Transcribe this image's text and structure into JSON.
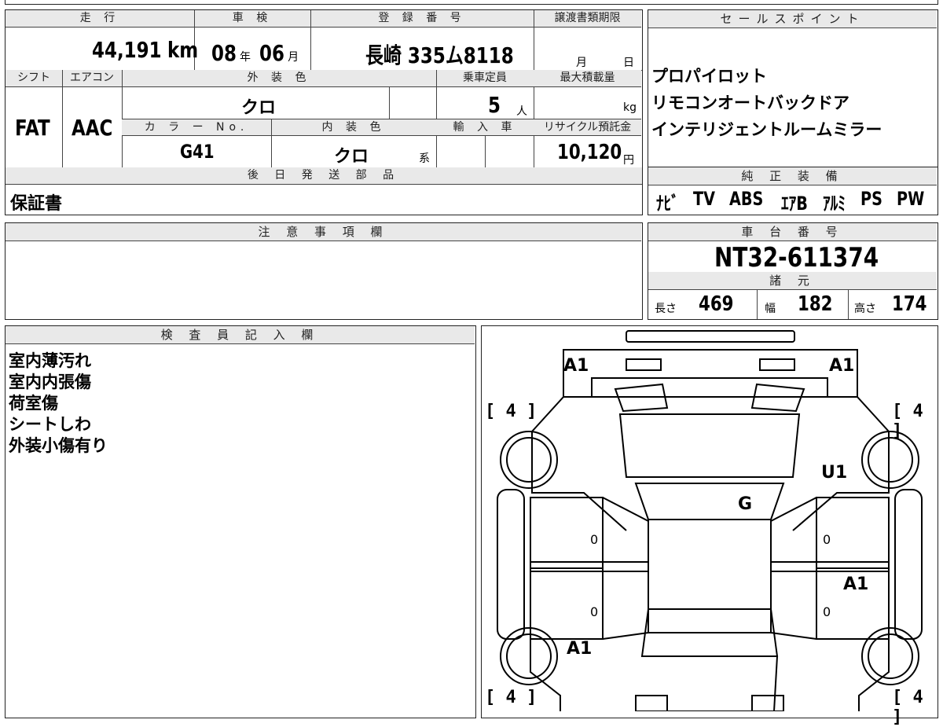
{
  "summary": {
    "mileage_label": "走 行",
    "mileage_value": "44,191",
    "mileage_unit": "km",
    "inspection_label": "車 検",
    "inspection_year": "08",
    "inspection_year_unit": "年",
    "inspection_month": "06",
    "inspection_month_unit": "月",
    "registration_label": "登 録 番 号",
    "registration_value": "長崎 335ム8118",
    "transfer_label": "譲渡書類期限",
    "transfer_month_unit": "月",
    "transfer_day_unit": "日",
    "shift_label": "シフト",
    "shift_value": "FAT",
    "aircon_label": "エアコン",
    "aircon_value": "AAC",
    "exterior_label": "外 装 色",
    "exterior_value": "クロ",
    "capacity_label": "乗車定員",
    "capacity_value": "5",
    "capacity_unit": "人",
    "max_load_label": "最大積載量",
    "max_load_unit": "kg",
    "color_no_label": "カ ラ ー No.",
    "color_no_value": "G41",
    "interior_label": "内 装 色",
    "interior_value": "クロ",
    "interior_suffix": "系",
    "import_label": "輸 入 車",
    "recycle_label": "リサイクル預託金",
    "recycle_value": "10,120",
    "recycle_unit": "円",
    "later_parts_label": "後 日 発 送 部 品",
    "later_parts_value": "保証書"
  },
  "sales_points": {
    "label": "セールスポイント",
    "items": [
      "プロパイロット",
      "リモコンオートバックドア",
      "インテリジェントルームミラー"
    ]
  },
  "equipment": {
    "label": "純 正 装 備",
    "items": [
      "ﾅﾋﾞ",
      "TV",
      "ABS",
      "ｴｱB",
      "ｱﾙﾐ",
      "PS",
      "PW"
    ]
  },
  "notes": {
    "label": "注 意 事 項 欄"
  },
  "chassis": {
    "label": "車 台 番 号",
    "value": "NT32-611374"
  },
  "specs": {
    "label": "諸 元",
    "length_label": "長さ",
    "length_value": "469",
    "width_label": "幅",
    "width_value": "182",
    "height_label": "高さ",
    "height_value": "174"
  },
  "inspector": {
    "label": "検 査 員 記 入 欄",
    "lines": [
      "室内薄汚れ",
      "室内内張傷",
      "荷室傷",
      "シートしわ",
      "外装小傷有り"
    ]
  },
  "diagram": {
    "marks": {
      "front_left": "A1",
      "front_right": "A1",
      "right_front_door": "U1",
      "roof": "G",
      "right_rear": "A1",
      "left_rear": "A1",
      "door_lf": "0",
      "door_lr": "0",
      "door_rf": "0",
      "door_rr": "0"
    },
    "tire_tl": "4",
    "tire_tr": "4",
    "tire_bl": "4",
    "tire_br": "4"
  }
}
